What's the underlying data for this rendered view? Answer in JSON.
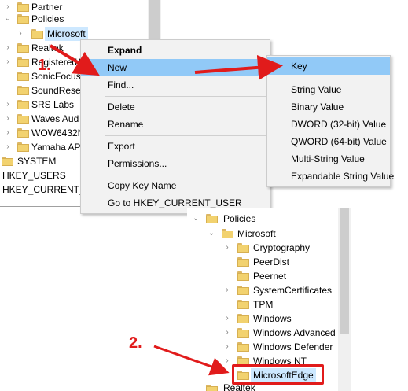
{
  "top_tree": {
    "items": [
      {
        "label": "Partner",
        "chevron": "›"
      },
      {
        "label": "Policies",
        "chevron": "⌄"
      },
      {
        "label": "Microsoft",
        "chevron": "›"
      },
      {
        "label": "Realtek",
        "chevron": "›"
      },
      {
        "label": "RegisteredA",
        "chevron": "›"
      },
      {
        "label": "SonicFocus",
        "chevron": ""
      },
      {
        "label": "SoundRese",
        "chevron": ""
      },
      {
        "label": "SRS Labs",
        "chevron": "›"
      },
      {
        "label": "Waves Aud",
        "chevron": "›"
      },
      {
        "label": "WOW6432N",
        "chevron": "›"
      },
      {
        "label": "Yamaha AP",
        "chevron": "›"
      },
      {
        "label": "SYSTEM",
        "chevron": "›"
      },
      {
        "label": "HKEY_USERS",
        "chevron": "›"
      },
      {
        "label": "HKEY_CURRENT_C",
        "chevron": "›"
      }
    ]
  },
  "context_menu": {
    "items": [
      "Expand",
      "New",
      "Find...",
      "Delete",
      "Rename",
      "Export",
      "Permissions...",
      "Copy Key Name",
      "Go to HKEY_CURRENT_USER"
    ],
    "new_arrow": "›"
  },
  "submenu": {
    "items": [
      "Key",
      "String Value",
      "Binary Value",
      "DWORD (32-bit) Value",
      "QWORD (64-bit) Value",
      "Multi-String Value",
      "Expandable String Value"
    ]
  },
  "bottom_tree": {
    "items": [
      {
        "label": "Policies",
        "chevron": "⌄"
      },
      {
        "label": "Microsoft",
        "chevron": "⌄"
      },
      {
        "label": "Cryptography",
        "chevron": "›"
      },
      {
        "label": "PeerDist",
        "chevron": ""
      },
      {
        "label": "Peernet",
        "chevron": ""
      },
      {
        "label": "SystemCertificates",
        "chevron": "›"
      },
      {
        "label": "TPM",
        "chevron": ""
      },
      {
        "label": "Windows",
        "chevron": "›"
      },
      {
        "label": "Windows Advanced",
        "chevron": "›"
      },
      {
        "label": "Windows Defender",
        "chevron": "›"
      },
      {
        "label": "Windows NT",
        "chevron": "›"
      },
      {
        "label": "MicrosoftEdge",
        "chevron": ""
      },
      {
        "label": "Realtek",
        "chevron": ""
      }
    ]
  },
  "annotations": {
    "step1": "1.",
    "step2": "2."
  },
  "colors": {
    "highlight": "#91c9f7",
    "annotation_red": "#e11b1b",
    "folder": "#f2d26f"
  }
}
